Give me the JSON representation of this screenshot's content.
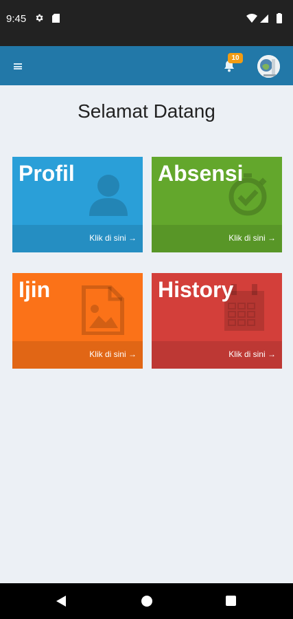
{
  "status_bar": {
    "time": "9:45"
  },
  "app_bar": {
    "notification_count": "10"
  },
  "main": {
    "title": "Selamat Datang",
    "tiles": [
      {
        "label": "Profil",
        "link": "Klik di sini",
        "color": "#2a9fd8",
        "icon": "user-icon"
      },
      {
        "label": "Absensi",
        "link": "Klik di sini",
        "color": "#63a72c",
        "icon": "check-circle-icon"
      },
      {
        "label": "Ijin",
        "link": "Klik di sini",
        "color": "#fb7218",
        "icon": "image-file-icon"
      },
      {
        "label": "History",
        "link": "Klik di sini",
        "color": "#d33f3a",
        "icon": "calendar-icon"
      }
    ]
  },
  "colors": {
    "app_bar": "#2278a8",
    "badge": "#f39c12",
    "background": "#ecf0f5"
  }
}
